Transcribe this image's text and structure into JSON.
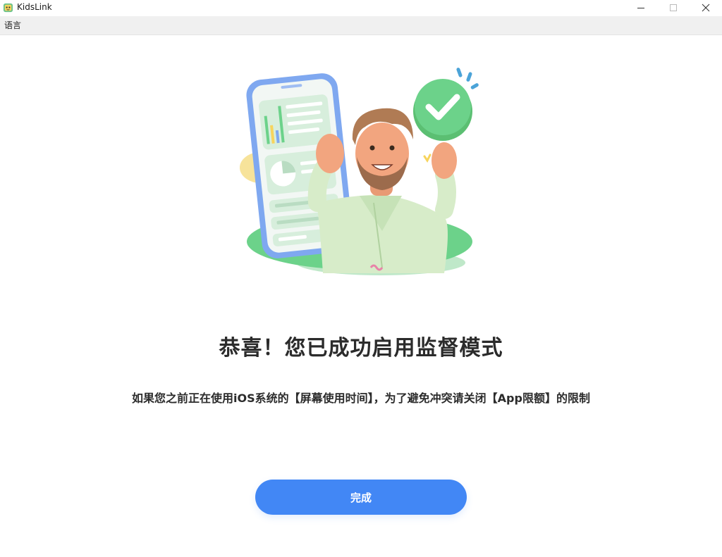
{
  "window": {
    "title": "KidsLink",
    "icon": "kidslink-app-icon",
    "controls": [
      "minimize-icon",
      "maximize-icon",
      "close-icon"
    ]
  },
  "menubar": {
    "items": [
      {
        "label": "语言"
      }
    ]
  },
  "main": {
    "illustration": "man-waving-with-phone-and-checkmark",
    "heading": "恭喜！您已成功启用监督模式",
    "subtext": "如果您之前正在使用iOS系统的【屏幕使用时间】，为了避免冲突请关闭【App限额】的限制",
    "done_label": "完成"
  },
  "colors": {
    "accent": "#4287f5",
    "success": "#6cd28a",
    "text": "#2b2b2b"
  }
}
